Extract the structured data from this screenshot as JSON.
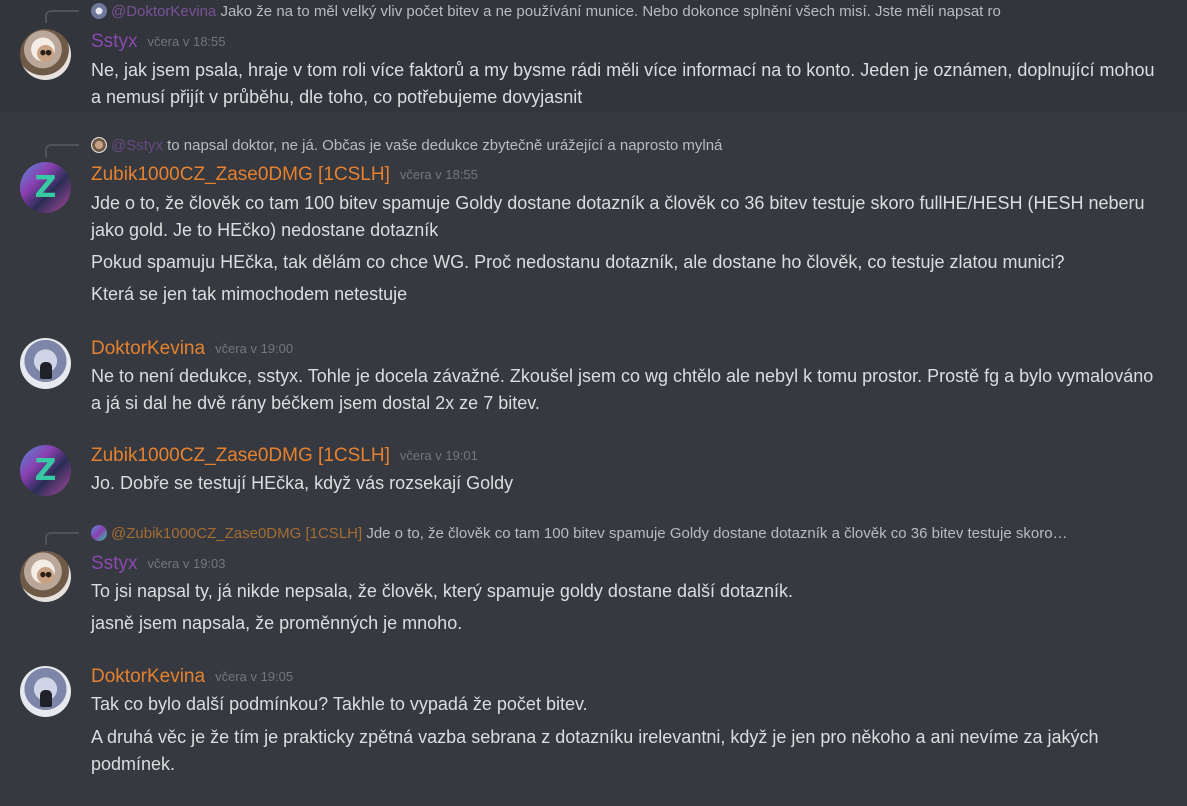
{
  "messages": [
    {
      "reply": {
        "mention": "@DoktorKevina",
        "text": "Jako že na to měl velký vliv počet bitev a ne používání munice. Nebo dokonce splnění všech misí. Jste měli napsat ro"
      },
      "author": "Sstyx",
      "timestamp": "včera v 18:55",
      "lines": [
        "Ne, jak jsem psala, hraje v tom roli více faktorů a my bysme rádi měli více informací na to konto. Jeden je oznámen, doplnující mohou a nemusí přijít v průběhu, dle toho, co potřebujeme dovyjasnit"
      ]
    },
    {
      "reply": {
        "mention": "@Sstyx",
        "text": "to napsal doktor, ne já. Občas je vaše dedukce zbytečně urážející a naprosto mylná"
      },
      "author": "Zubik1000CZ_Zase0DMG [1CSLH]",
      "timestamp": "včera v 18:55",
      "lines": [
        "Jde o to, že člověk co tam 100 bitev spamuje Goldy dostane dotazník a člověk co 36 bitev testuje skoro fullHE/HESH (HESH neberu jako gold. Je to HEčko) nedostane dotazník",
        "Pokud spamuju HEčka, tak dělám co chce WG.  Proč nedostanu dotazník, ale dostane ho člověk, co testuje zlatou munici?",
        "Která se jen tak mimochodem netestuje"
      ]
    },
    {
      "author": "DoktorKevina",
      "timestamp": "včera v 19:00",
      "lines": [
        "Ne to není dedukce, sstyx. Tohle je docela závažné. Zkoušel jsem co wg chtělo ale nebyl k tomu prostor. Prostě fg a bylo vymalováno a já si dal he dvě rány béčkem jsem dostal 2x ze 7 bitev."
      ]
    },
    {
      "author": "Zubik1000CZ_Zase0DMG [1CSLH]",
      "timestamp": "včera v 19:01",
      "lines": [
        "Jo. Dobře se testují HEčka, když vás rozsekají Goldy"
      ]
    },
    {
      "reply": {
        "mention": "@Zubik1000CZ_Zase0DMG [1CSLH]",
        "text": "Jde o to, že člověk co tam 100 bitev spamuje Goldy dostane dotazník a člověk co 36 bitev testuje skoro…"
      },
      "author": "Sstyx",
      "timestamp": "včera v 19:03",
      "lines": [
        "To jsi napsal ty, já nikde nepsala, že člověk, který spamuje goldy dostane další dotazník.",
        "jasně jsem napsala, že proměnných je mnoho."
      ]
    },
    {
      "author": "DoktorKevina",
      "timestamp": "včera v 19:05",
      "lines": [
        "Tak co bylo další podmínkou? Takhle to vypadá že počet bitev.",
        "A druhá věc je že tím je prakticky zpětná vazba sebrana z dotazníku irelevantni, když je jen pro někoho a ani nevíme za jakých podmínek."
      ]
    }
  ]
}
